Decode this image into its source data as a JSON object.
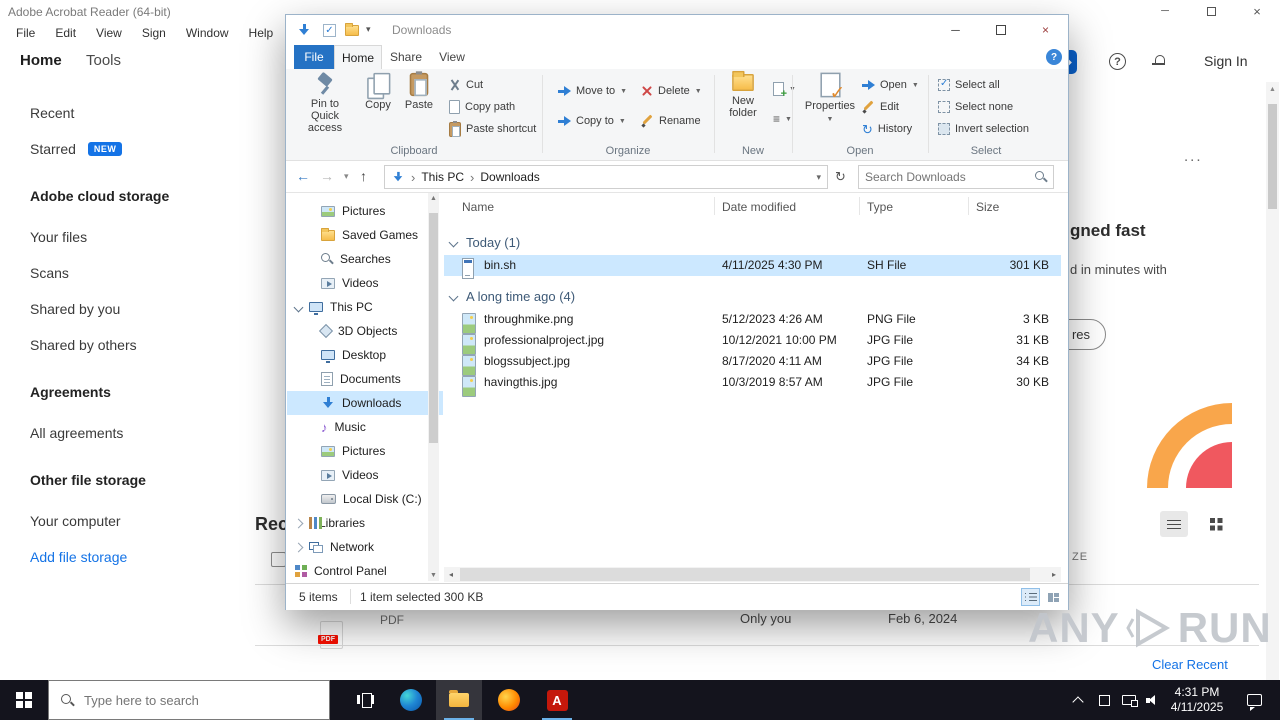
{
  "acrobat": {
    "title": "Adobe Acrobat Reader (64-bit)",
    "menu": [
      "File",
      "Edit",
      "View",
      "Sign",
      "Window",
      "Help"
    ],
    "tabs": [
      "Home",
      "Tools"
    ],
    "sign_in": "Sign In",
    "sidebar": {
      "recent": "Recent",
      "starred": "Starred",
      "starred_badge": "NEW",
      "section1_header": "Adobe cloud storage",
      "section1_items": [
        "Your files",
        "Scans",
        "Shared by you",
        "Shared by others"
      ],
      "section2_header": "Agreements",
      "section2_items": [
        "All agreements"
      ],
      "section3_header": "Other file storage",
      "section3_items": [
        "Your computer",
        "Add file storage"
      ]
    },
    "content": {
      "more_ellipsis": "...",
      "hero_heading_fragment": "gned fast",
      "hero_body_fragment": "d in minutes with",
      "hero_button_fragment": "res",
      "recent_heading_fragment": "Rec",
      "size_column_fragment": "ZE",
      "pdf_badge": "PDF",
      "pdf_type_label": "PDF",
      "shared_label": "Only you",
      "date_label": "Feb 6, 2024",
      "clear_recent": "Clear Recent"
    }
  },
  "explorer": {
    "title": "Downloads",
    "tabs": [
      "File",
      "Home",
      "Share",
      "View"
    ],
    "ribbon": {
      "pin_line1": "Pin to Quick",
      "pin_line2": "access",
      "copy": "Copy",
      "paste": "Paste",
      "cut": "Cut",
      "copy_path": "Copy path",
      "paste_shortcut": "Paste shortcut",
      "move_to": "Move to",
      "copy_to": "Copy to",
      "delete": "Delete",
      "rename": "Rename",
      "new_folder_line1": "New",
      "new_folder_line2": "folder",
      "properties": "Properties",
      "open": "Open",
      "edit": "Edit",
      "history": "History",
      "select_all": "Select all",
      "select_none": "Select none",
      "invert_selection": "Invert selection",
      "group_clipboard": "Clipboard",
      "group_organize": "Organize",
      "group_new": "New",
      "group_open": "Open",
      "group_select": "Select"
    },
    "address": {
      "crumb_root": "This PC",
      "crumb_current": "Downloads",
      "search_placeholder": "Search Downloads"
    },
    "nav": [
      {
        "label": "Pictures"
      },
      {
        "label": "Saved Games"
      },
      {
        "label": "Searches"
      },
      {
        "label": "Videos"
      },
      {
        "label": "This PC"
      },
      {
        "label": "3D Objects"
      },
      {
        "label": "Desktop"
      },
      {
        "label": "Documents"
      },
      {
        "label": "Downloads"
      },
      {
        "label": "Music"
      },
      {
        "label": "Pictures"
      },
      {
        "label": "Videos"
      },
      {
        "label": "Local Disk (C:)"
      },
      {
        "label": "Libraries"
      },
      {
        "label": "Network"
      },
      {
        "label": "Control Panel"
      }
    ],
    "columns": [
      "Name",
      "Date modified",
      "Type",
      "Size"
    ],
    "groups": [
      {
        "label": "Today (1)"
      },
      {
        "label": "A long time ago (4)"
      }
    ],
    "files": [
      {
        "name": "bin.sh",
        "date": "4/11/2025 4:30 PM",
        "type": "SH File",
        "size": "301 KB"
      },
      {
        "name": "throughmike.png",
        "date": "5/12/2023 4:26 AM",
        "type": "PNG File",
        "size": "3 KB"
      },
      {
        "name": "professionalproject.jpg",
        "date": "10/12/2021 10:00 PM",
        "type": "JPG File",
        "size": "31 KB"
      },
      {
        "name": "blogssubject.jpg",
        "date": "8/17/2020 4:11 AM",
        "type": "JPG File",
        "size": "34 KB"
      },
      {
        "name": "havingthis.jpg",
        "date": "10/3/2019 8:57 AM",
        "type": "JPG File",
        "size": "30 KB"
      }
    ],
    "status": {
      "count": "5 items",
      "selected": "1 item selected",
      "selected_size": "300 KB"
    }
  },
  "taskbar": {
    "search_placeholder": "Type here to search",
    "time": "4:31 PM",
    "date": "4/11/2025"
  },
  "watermark": {
    "any": "ANY",
    "run": "RUN"
  }
}
